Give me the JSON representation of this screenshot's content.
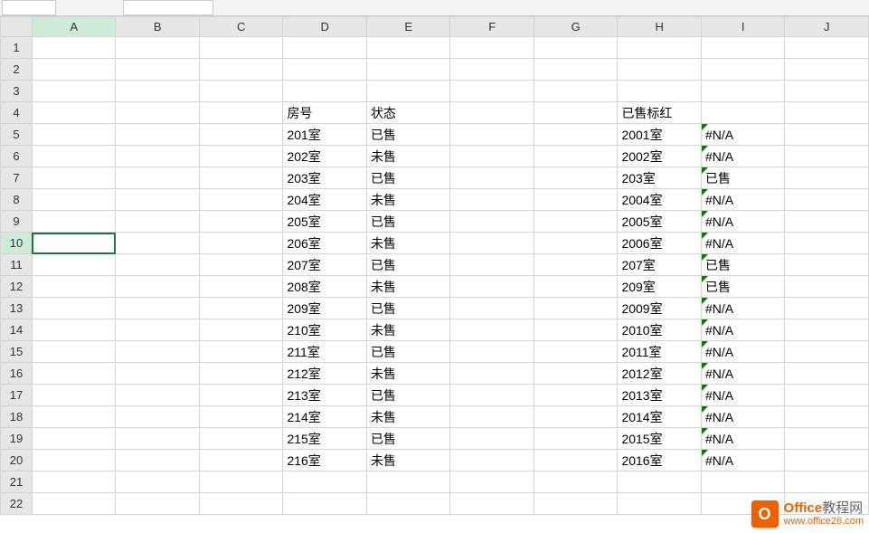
{
  "columns": [
    "A",
    "B",
    "C",
    "D",
    "E",
    "F",
    "G",
    "H",
    "I",
    "J"
  ],
  "row_count": 22,
  "active_cell": {
    "row": 10,
    "col": "A"
  },
  "cells": {
    "D4": "房号",
    "E4": "状态",
    "H4": "已售标红",
    "D5": "201室",
    "E5": "已售",
    "H5": "2001室",
    "I5": "#N/A",
    "D6": "202室",
    "E6": "未售",
    "H6": "2002室",
    "I6": "#N/A",
    "D7": "203室",
    "E7": "已售",
    "H7": "203室",
    "I7": "已售",
    "D8": "204室",
    "E8": "未售",
    "H8": "2004室",
    "I8": "#N/A",
    "D9": "205室",
    "E9": "已售",
    "H9": "2005室",
    "I9": "#N/A",
    "D10": "206室",
    "E10": "未售",
    "H10": "2006室",
    "I10": "#N/A",
    "D11": "207室",
    "E11": "已售",
    "H11": "207室",
    "I11": "已售",
    "D12": "208室",
    "E12": "未售",
    "H12": "209室",
    "I12": "已售",
    "D13": "209室",
    "E13": "已售",
    "H13": "2009室",
    "I13": "#N/A",
    "D14": "210室",
    "E14": "未售",
    "H14": "2010室",
    "I14": "#N/A",
    "D15": "211室",
    "E15": "已售",
    "H15": "2011室",
    "I15": "#N/A",
    "D16": "212室",
    "E16": "未售",
    "H16": "2012室",
    "I16": "#N/A",
    "D17": "213室",
    "E17": "已售",
    "H17": "2013室",
    "I17": "#N/A",
    "D18": "214室",
    "E18": "未售",
    "H18": "2014室",
    "I18": "#N/A",
    "D19": "215室",
    "E19": "已售",
    "H19": "2015室",
    "I19": "#N/A",
    "D20": "216室",
    "E20": "未售",
    "H20": "2016室",
    "I20": "#N/A"
  },
  "error_indicator_cells": [
    "I5",
    "I6",
    "I7",
    "I8",
    "I9",
    "I10",
    "I11",
    "I12",
    "I13",
    "I14",
    "I15",
    "I16",
    "I17",
    "I18",
    "I19",
    "I20"
  ],
  "watermark": {
    "logo_letter": "O",
    "line1_bold": "Office",
    "line1_rest": "教程网",
    "line2": "www.office26.com"
  }
}
